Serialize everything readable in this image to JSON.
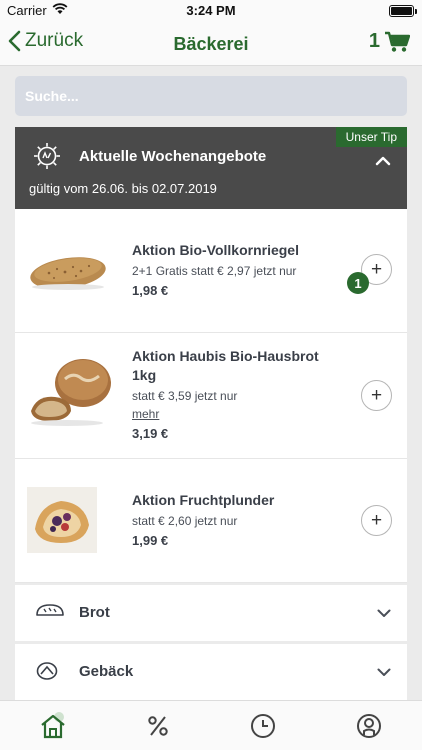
{
  "status_bar": {
    "carrier": "Carrier",
    "time": "3:24 PM"
  },
  "nav": {
    "back_label": "Zurück",
    "title": "Bäckerei",
    "cart_count": "1"
  },
  "search": {
    "placeholder": "Suche..."
  },
  "offers": {
    "badge": "Unser Tip",
    "title": "Aktuelle Wochenangebote",
    "validity": "gültig vom 26.06. bis 02.07.2019"
  },
  "products": [
    {
      "name": "Aktion Bio-Vollkornriegel",
      "desc": "2+1 Gratis statt € 2,97 jetzt nur",
      "price": "1,98 €",
      "quantity": "1"
    },
    {
      "name_line1": "Aktion Haubis Bio-Hausbrot",
      "name_line2": "1kg",
      "desc": "statt € 3,59 jetzt nur",
      "more": "mehr",
      "price": "3,19 €"
    },
    {
      "name": "Aktion Fruchtplunder",
      "desc": "statt € 2,60 jetzt nur",
      "price": "1,99 €"
    }
  ],
  "categories": [
    {
      "label": "Brot",
      "icon": "bread-icon"
    },
    {
      "label": "Gebäck",
      "icon": "pretzel-icon"
    }
  ],
  "tabs": [
    "home-icon",
    "percent-icon",
    "clock-icon",
    "profile-icon"
  ],
  "colors": {
    "brand_green": "#2a6a2f",
    "header_dark": "#4a4a4a"
  }
}
